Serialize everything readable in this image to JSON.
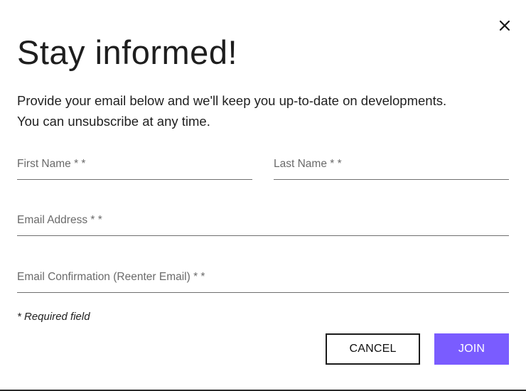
{
  "dialog": {
    "title": "Stay informed!",
    "description_line1": "Provide your email below and we'll keep you up-to-date on developments.",
    "description_line2": "You can unsubscribe at any time.",
    "close_icon": "close-icon"
  },
  "form": {
    "first_name": {
      "placeholder": "First Name * *",
      "value": ""
    },
    "last_name": {
      "placeholder": "Last Name * *",
      "value": ""
    },
    "email": {
      "placeholder": "Email Address * *",
      "value": ""
    },
    "email_confirm": {
      "placeholder": "Email Confirmation (Reenter Email) * *",
      "value": ""
    },
    "required_note": "* Required field"
  },
  "actions": {
    "cancel_label": "CANCEL",
    "join_label": "JOIN"
  },
  "colors": {
    "accent": "#7a5cff",
    "text": "#1f1f1f",
    "border": "#6f6f6f"
  }
}
